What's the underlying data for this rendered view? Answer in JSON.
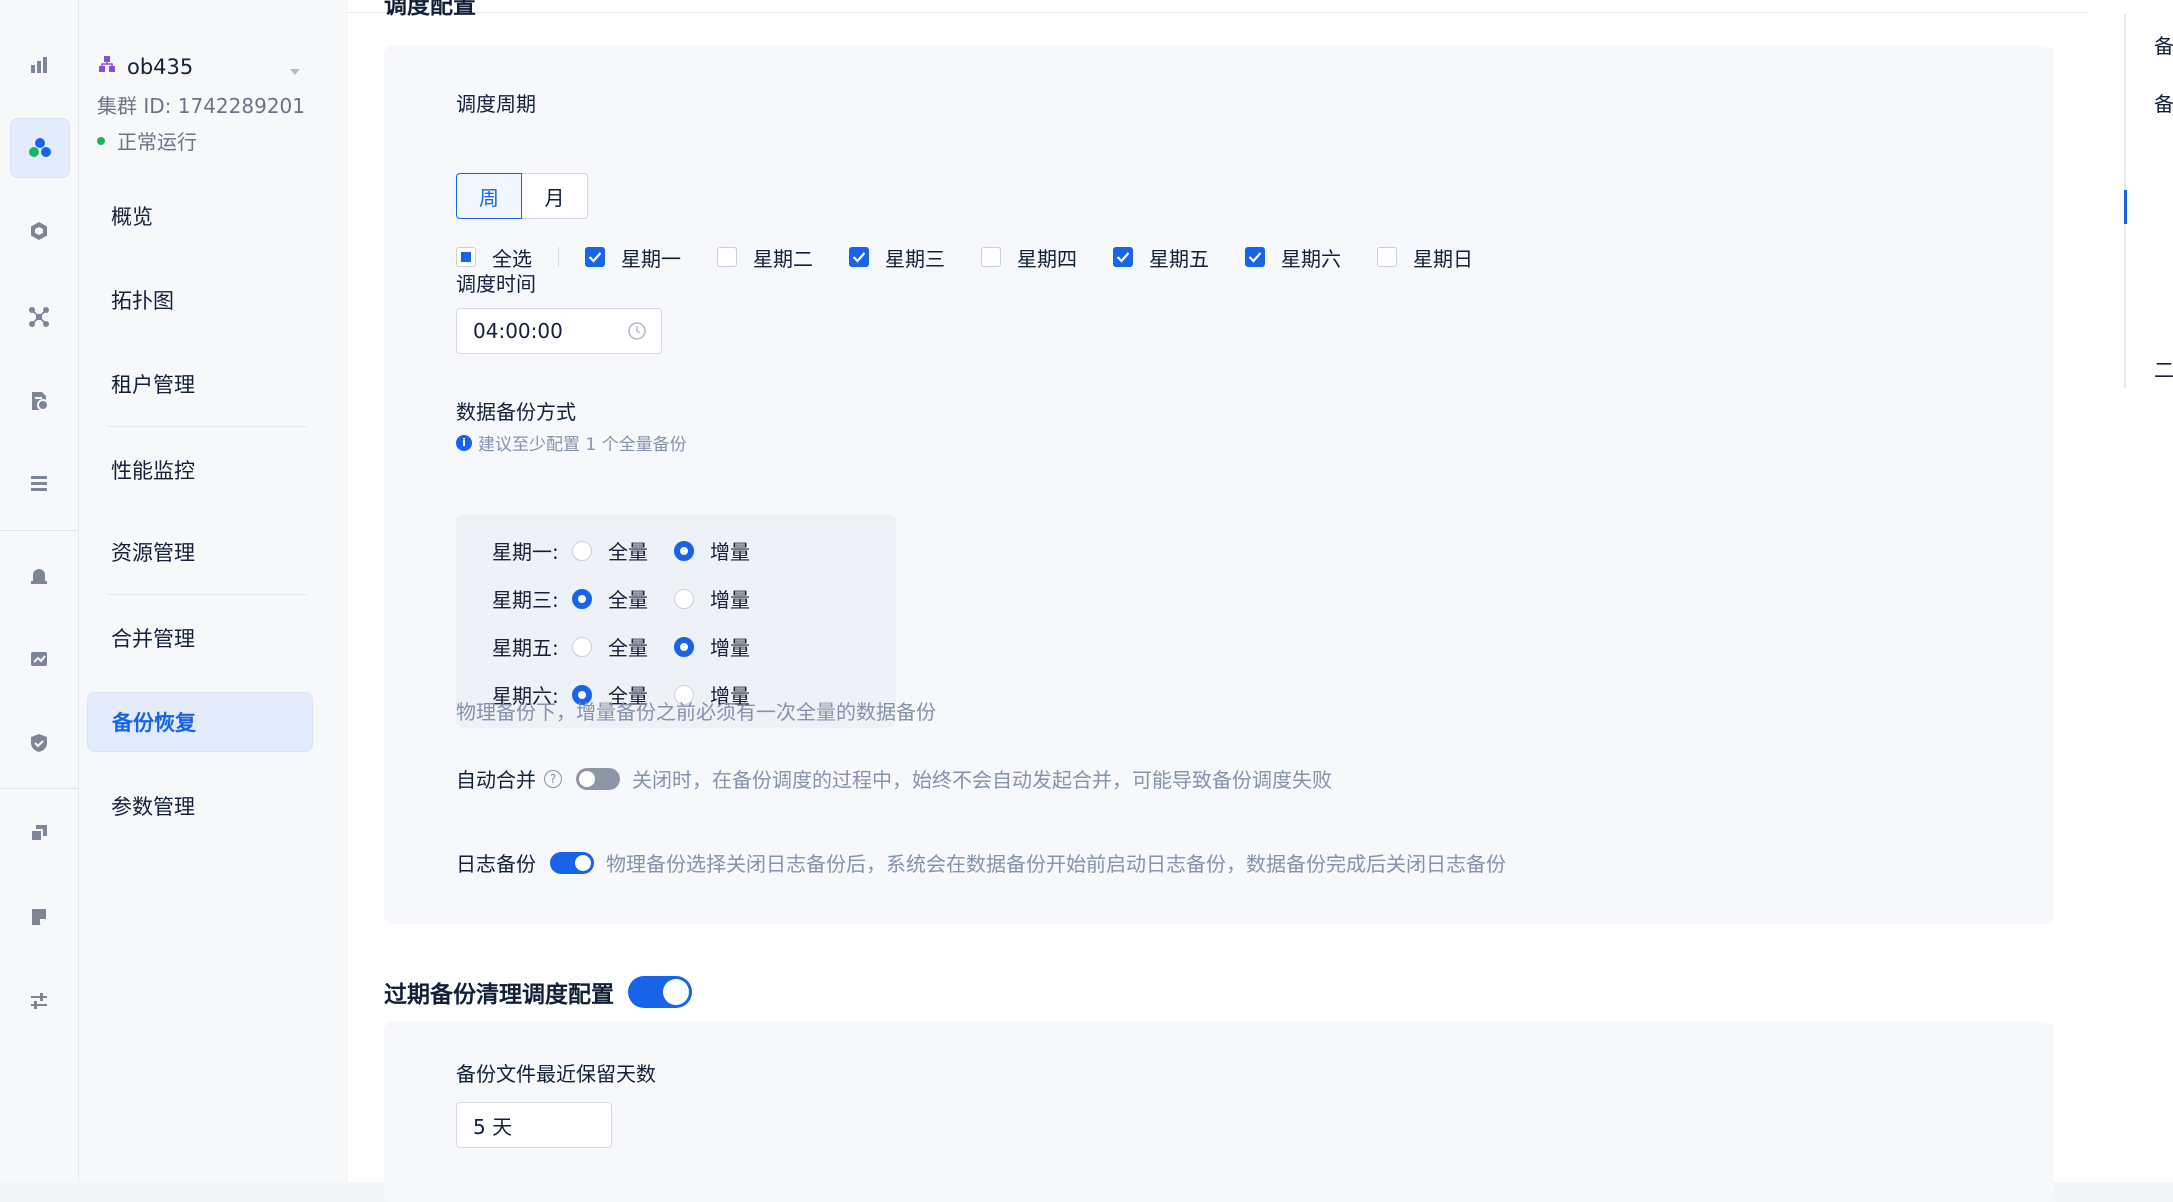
{
  "rail": {
    "icons": [
      "chart-bar-icon",
      "cluster-icon",
      "hexagon-icon",
      "topology-icon",
      "document-gear-icon",
      "list-icon",
      "alarm-icon",
      "monitor-chart-icon",
      "shield-icon",
      "copy-icon",
      "note-icon",
      "sliders-icon"
    ]
  },
  "cluster": {
    "name": "ob435",
    "id_text": "集群 ID: 1742289201",
    "status": "正常运行",
    "status_color": "#19b65c"
  },
  "menu": {
    "items": [
      "概览",
      "拓扑图",
      "租户管理",
      "性能监控",
      "资源管理",
      "合并管理",
      "备份恢复",
      "参数管理"
    ],
    "active": "备份恢复"
  },
  "schedule": {
    "title": "调度配置",
    "period_label": "调度周期",
    "period_options": [
      "周",
      "月"
    ],
    "period_selected": "周",
    "select_all": "全选",
    "days": [
      {
        "label": "星期一",
        "checked": true
      },
      {
        "label": "星期二",
        "checked": false
      },
      {
        "label": "星期三",
        "checked": true
      },
      {
        "label": "星期四",
        "checked": false
      },
      {
        "label": "星期五",
        "checked": true
      },
      {
        "label": "星期六",
        "checked": true
      },
      {
        "label": "星期日",
        "checked": false
      }
    ],
    "time_label": "调度时间",
    "time_value": "04:00:00",
    "mode_label": "数据备份方式",
    "mode_hint": "建议至少配置 1 个全量备份",
    "full_label": "全量",
    "incr_label": "增量",
    "mode_rows": [
      {
        "day": "星期一:",
        "mode": "incr"
      },
      {
        "day": "星期三:",
        "mode": "full"
      },
      {
        "day": "星期五:",
        "mode": "incr"
      },
      {
        "day": "星期六:",
        "mode": "full"
      }
    ],
    "mode_note": "物理备份下，增量备份之前必须有一次全量的数据备份",
    "auto_merge_label": "自动合并",
    "auto_merge_on": false,
    "auto_merge_desc": "关闭时，在备份调度的过程中，始终不会自动发起合并，可能导致备份调度失败",
    "log_backup_label": "日志备份",
    "log_backup_on": true,
    "log_backup_desc": "物理备份选择关闭日志备份后，系统会在数据备份开始前启动日志备份，数据备份完成后关闭日志备份"
  },
  "cleanup": {
    "title": "过期备份清理调度配置",
    "enabled": true,
    "retain_label": "备份文件最近保留天数",
    "retain_value": "5 天"
  },
  "anchor": {
    "items": [
      "备",
      "备",
      "二"
    ]
  },
  "colors": {
    "accent": "#1764e8",
    "muted": "#8592ad"
  }
}
